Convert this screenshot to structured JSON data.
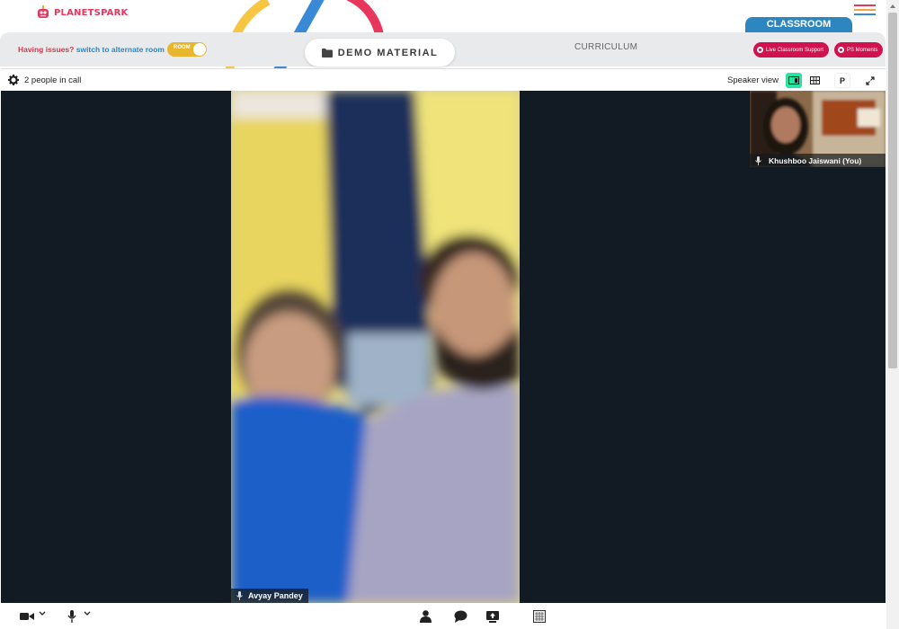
{
  "header": {
    "brand": "PLANETSPARK",
    "classroom_tab": "CLASSROOM"
  },
  "subbar": {
    "issues_text": "Having issues?",
    "switch_link": "switch to alternate room",
    "toggle_label": "ROOM",
    "demo_material": "DEMO MATERIAL",
    "curriculum": "CURRICULUM",
    "live_support": "Live Classroom Support",
    "ps_moments": "PS Moments"
  },
  "call": {
    "people_count": "2 people in call",
    "view_mode": "Speaker view",
    "p_button": "P"
  },
  "participants": {
    "main": "Avyay Pandey",
    "self": "Khushboo Jaiswani (You)"
  },
  "colors": {
    "accent_red": "#d0124e",
    "classroom_blue": "#2e86c1",
    "active_view": "#27e3a5",
    "stage_bg": "#121b24"
  }
}
